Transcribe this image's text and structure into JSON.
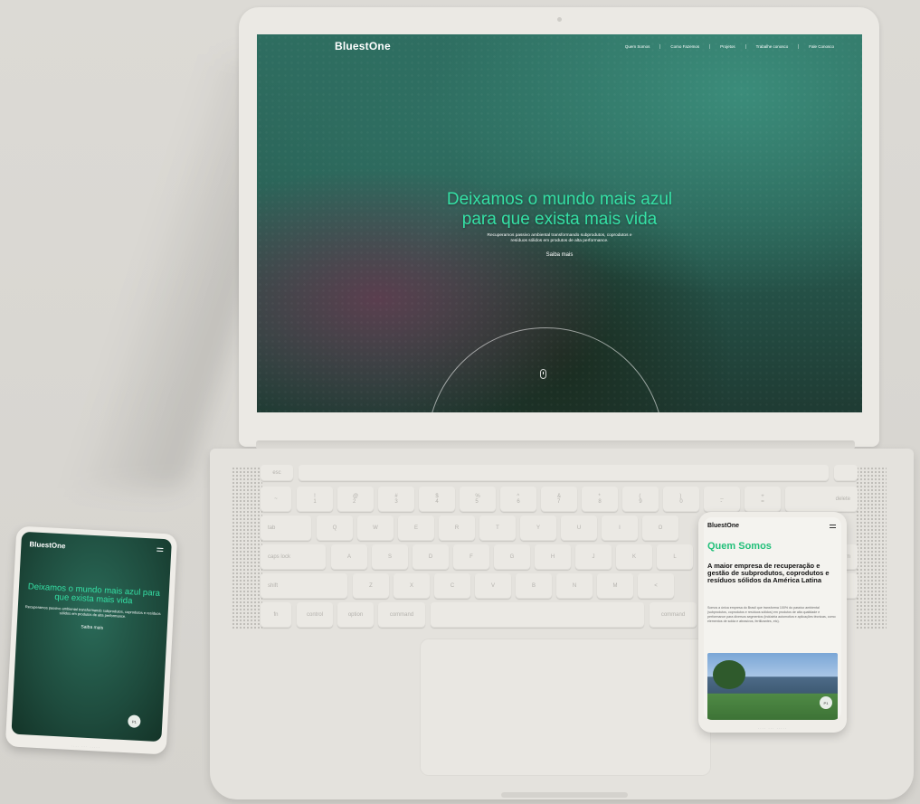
{
  "laptop": {
    "site": {
      "logo": "BluestOne",
      "nav": [
        "Quem Somos",
        "Como Fazemos",
        "Projetos",
        "Trabalhe conosco",
        "Fale Conosco"
      ],
      "hero": {
        "title_line1": "Deixamos o mundo mais azul",
        "title_line2": "para que exista mais vida",
        "subtitle_line1": "Recuperamos passivo ambiental transformando subprodutos, coprodutos e",
        "subtitle_line2": "resíduos sólidos em produtos de alta performance.",
        "cta": "Saiba mais"
      }
    },
    "keys": {
      "esc": "esc",
      "tab": "tab",
      "caps": "caps lock",
      "shift_l": "shift",
      "shift_r": "shift",
      "fn": "fn",
      "control": "control",
      "option": "option",
      "command_l": "command",
      "command_r": "command",
      "delete": "delete",
      "return": "return",
      "row1": [
        "!\n1",
        "@\n2",
        "#\n3",
        "$\n4",
        "%\n5",
        "^\n6",
        "&\n7",
        "*\n8",
        "(\n9",
        ")\n0",
        "_\n-",
        "+\n="
      ],
      "row2": [
        "Q",
        "W",
        "E",
        "R",
        "T",
        "Y",
        "U",
        "I",
        "O"
      ],
      "row3": [
        "A",
        "S",
        "D",
        "F",
        "G",
        "H",
        "J",
        "K",
        "L"
      ],
      "row4": [
        "Z",
        "X",
        "C",
        "V",
        "B",
        "N",
        "M",
        "<"
      ]
    }
  },
  "phone_left": {
    "logo": "BluestOne",
    "hero_title": "Deixamos o mundo mais azul para que exista mais vida",
    "hero_text": "Recuperamos passivo ambiental transformando subprodutos, coprodutos e resíduos sólidos em produtos de alta performance.",
    "cta": "Saiba mais",
    "badge": "P1"
  },
  "phone_right": {
    "logo": "BluestOne",
    "title": "Quem Somos",
    "subtitle": "A maior empresa de recuperação e gestão de subprodutos, coprodutos e resíduos sólidos da América Latina",
    "body": "Somos a única empresa do Brasil que transforma 100% do passivo ambiental (subprodutos, coprodutos e resíduos sólidos) em produtos de alta qualidade e performance para diversos segmentos (indústria automotiva e aplicações técnicas, como elementos de solda e abrasivos, fertilizantes, etc).",
    "badge": "P1"
  }
}
